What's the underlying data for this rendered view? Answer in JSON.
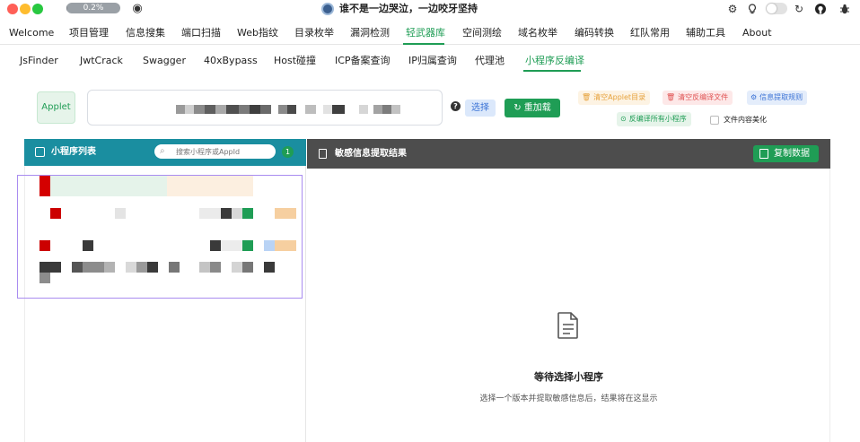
{
  "window": {
    "title": "谁不是一边哭泣，一边咬牙坚持",
    "progress_text": "0.2%",
    "progress_value": 0.002
  },
  "main_nav": {
    "items": [
      {
        "label": "Welcome"
      },
      {
        "label": "项目管理"
      },
      {
        "label": "信息搜集"
      },
      {
        "label": "端口扫描"
      },
      {
        "label": "Web指纹"
      },
      {
        "label": "目录枚举"
      },
      {
        "label": "漏洞检测"
      },
      {
        "label": "轻武器库"
      },
      {
        "label": "空间测绘"
      },
      {
        "label": "域名枚举"
      },
      {
        "label": "编码转换"
      },
      {
        "label": "红队常用"
      },
      {
        "label": "辅助工具"
      },
      {
        "label": "About"
      }
    ],
    "active": "轻武器库"
  },
  "sub_nav": {
    "items": [
      {
        "label": "JsFinder"
      },
      {
        "label": "JwtCrack"
      },
      {
        "label": "Swagger"
      },
      {
        "label": "40xBypass"
      },
      {
        "label": "Host碰撞"
      },
      {
        "label": "ICP备案查询"
      },
      {
        "label": "IP归属查询"
      },
      {
        "label": "代理池"
      },
      {
        "label": "小程序反编译"
      }
    ],
    "active": "小程序反编译"
  },
  "toolbar": {
    "applet_label": "Applet",
    "select_label": "选择",
    "reload_label": "重加载",
    "clear_applet_label": "清空Applet目录",
    "clear_decompile_label": "清空反编译文件",
    "rules_label": "信息提取规则",
    "decompile_all_label": "反编译所有小程序",
    "beautify_label": "文件内容美化",
    "beautify_checked": false
  },
  "left_panel": {
    "title": "小程序列表",
    "search_placeholder": "搜索小程序或AppId",
    "count": "1"
  },
  "right_panel": {
    "title": "敏感信息提取结果",
    "copy_label": "复制数据",
    "empty_title": "等待选择小程序",
    "empty_subtitle": "选择一个版本并提取敏感信息后，结果将在这显示"
  },
  "colors": {
    "accent": "#1f9d55",
    "left_header": "#1a8ea0",
    "right_header": "#4d4d4d",
    "selection": "#a98cf0",
    "clear_applet": "#e6a23c",
    "clear_decompile": "#e05252",
    "rules": "#3b73d6"
  }
}
